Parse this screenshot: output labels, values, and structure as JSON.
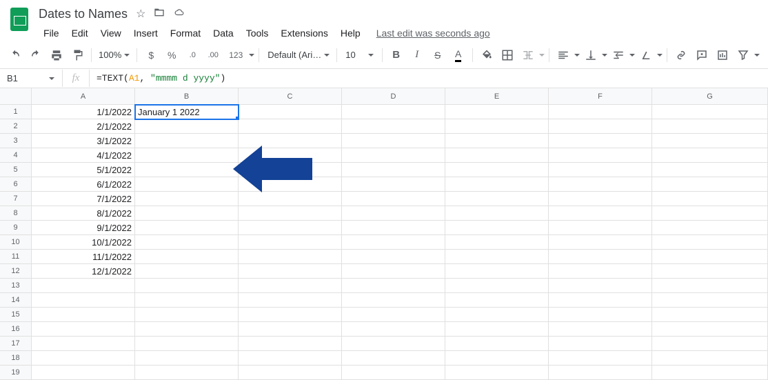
{
  "doc": {
    "title": "Dates to Names"
  },
  "menus": {
    "file": "File",
    "edit": "Edit",
    "view": "View",
    "insert": "Insert",
    "format": "Format",
    "data": "Data",
    "tools": "Tools",
    "extensions": "Extensions",
    "help": "Help",
    "last_edit": "Last edit was seconds ago"
  },
  "toolbar": {
    "zoom": "100%",
    "font": "Default (Ari…",
    "font_size": "10",
    "currency": "$",
    "percent": "%",
    "dec_minus": ".0",
    "dec_plus": ".00",
    "fmt123": "123"
  },
  "formula_bar": {
    "cell_ref": "B1",
    "raw": "=TEXT(A1, \"mmmm d yyyy\")",
    "func": "=TEXT",
    "open": "(",
    "ref": "A1",
    "sep": ", ",
    "arg2": "\"mmmm d yyyy\"",
    "close": ")"
  },
  "columns": [
    "A",
    "B",
    "C",
    "D",
    "E",
    "F",
    "G"
  ],
  "row_count": 19,
  "cells": {
    "a": [
      "1/1/2022",
      "2/1/2022",
      "3/1/2022",
      "4/1/2022",
      "5/1/2022",
      "6/1/2022",
      "7/1/2022",
      "8/1/2022",
      "9/1/2022",
      "10/1/2022",
      "11/1/2022",
      "12/1/2022",
      "",
      "",
      "",
      "",
      "",
      "",
      ""
    ],
    "b": [
      "January 1 2022",
      "",
      "",
      "",
      "",
      "",
      "",
      "",
      "",
      "",
      "",
      "",
      "",
      "",
      "",
      "",
      "",
      "",
      ""
    ]
  }
}
